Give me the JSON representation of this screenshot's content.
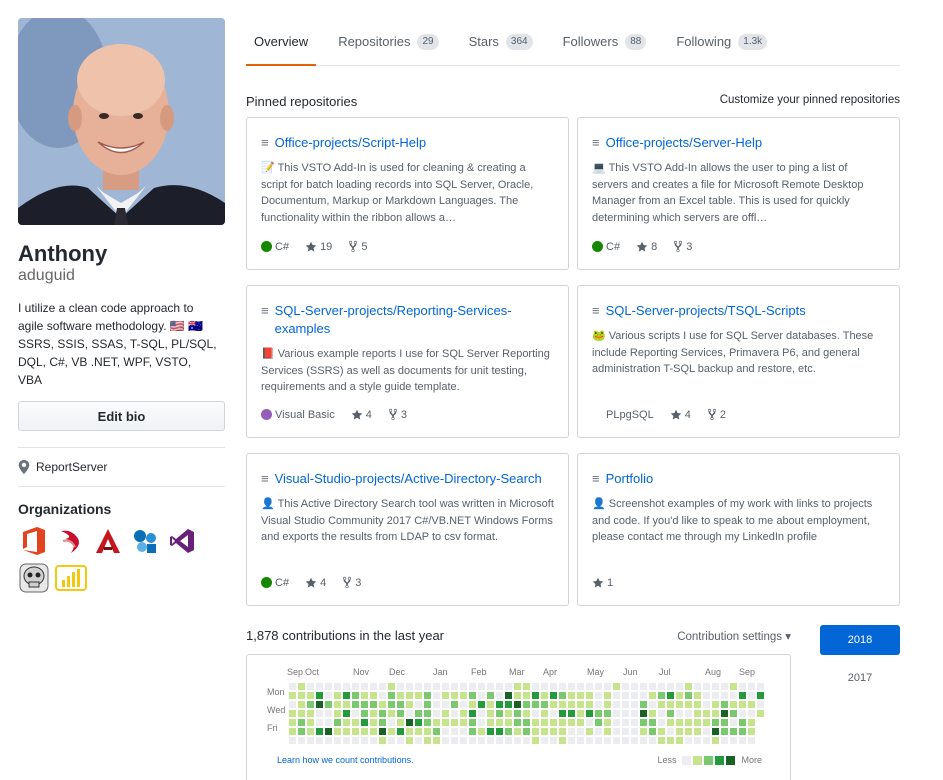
{
  "profile": {
    "name": "Anthony",
    "login": "aduguid",
    "bio_line1": "I utilize a clean code approach to agile software methodology. 🇺🇸 🇦🇺",
    "bio_line2": "SSRS, SSIS, SSAS, T-SQL, PL/SQL, DQL, C#, VB .NET, WPF, VSTO, VBA",
    "edit_bio_label": "Edit bio",
    "location": "ReportServer",
    "organizations_title": "Organizations",
    "org_icons": [
      "office-icon",
      "sql-server-icon",
      "autodesk-icon",
      "sharepoint-icon",
      "visual-studio-icon",
      "skull-icon",
      "power-bi-icon"
    ]
  },
  "tabs": [
    {
      "label": "Overview",
      "count": "",
      "selected": true
    },
    {
      "label": "Repositories",
      "count": "29"
    },
    {
      "label": "Stars",
      "count": "364"
    },
    {
      "label": "Followers",
      "count": "88"
    },
    {
      "label": "Following",
      "count": "1.3k"
    }
  ],
  "pinned": {
    "title": "Pinned repositories",
    "customize_label": "Customize your pinned repositories",
    "repos": [
      {
        "name": "Office-projects/Script-Help",
        "emoji": "📝",
        "description": "This VSTO Add-In is used for cleaning & creating a script for batch loading records into SQL Server, Oracle, Documentum, Markup or Markdown Languages. The functionality within the ribbon allows a…",
        "language": "C#",
        "lang_color": "#178600",
        "stars": "19",
        "forks": "5"
      },
      {
        "name": "Office-projects/Server-Help",
        "emoji": "💻",
        "description": "This VSTO Add-In allows the user to ping a list of servers and creates a file for Microsoft Remote Desktop Manager from an Excel table. This is used for quickly determining which servers are offl…",
        "language": "C#",
        "lang_color": "#178600",
        "stars": "8",
        "forks": "3"
      },
      {
        "name": "SQL-Server-projects/Reporting-Services-examples",
        "emoji": "📕",
        "description": "Various example reports I use for SQL Server Reporting Services (SSRS) as well as documents for unit testing, requirements and a style guide template.",
        "language": "Visual Basic",
        "lang_color": "#945db7",
        "stars": "4",
        "forks": "3"
      },
      {
        "name": "SQL-Server-projects/TSQL-Scripts",
        "emoji": "🐸",
        "description": "Various scripts I use for SQL Server databases. These include Reporting Services, Primavera P6, and general administration T-SQL backup and restore, etc.",
        "language": "PLpgSQL",
        "lang_color": "",
        "stars": "4",
        "forks": "2"
      },
      {
        "name": "Visual-Studio-projects/Active-Directory-Search",
        "emoji": "👤",
        "description": "This Active Directory Search tool was written in Microsoft Visual Studio Community 2017 C#/VB.NET Windows Forms and exports the results from LDAP to csv format.",
        "language": "C#",
        "lang_color": "#178600",
        "stars": "4",
        "forks": "3"
      },
      {
        "name": "Portfolio",
        "emoji": "👤",
        "description": "Screenshot examples of my work with links to projects and code. If you'd like to speak to me about employment, please contact me through my LinkedIn profile",
        "language": "",
        "lang_color": "",
        "stars": "1",
        "forks": ""
      }
    ]
  },
  "contributions": {
    "title": "1,878 contributions in the last year",
    "settings_label": "Contribution settings ▾",
    "months": [
      "Sep",
      "Oct",
      "Nov",
      "Dec",
      "Jan",
      "Feb",
      "Mar",
      "Apr",
      "May",
      "Jun",
      "Jul",
      "Aug",
      "Sep"
    ],
    "days": [
      "Mon",
      "Wed",
      "Fri"
    ],
    "learn_label": "Learn how we count contributions.",
    "less_label": "Less",
    "more_label": "More",
    "colors": [
      "#ebedf0",
      "#c6e48b",
      "#7bc96f",
      "#239a3b",
      "#196127"
    ],
    "years": [
      {
        "label": "2018",
        "selected": true
      },
      {
        "label": "2017"
      }
    ]
  }
}
